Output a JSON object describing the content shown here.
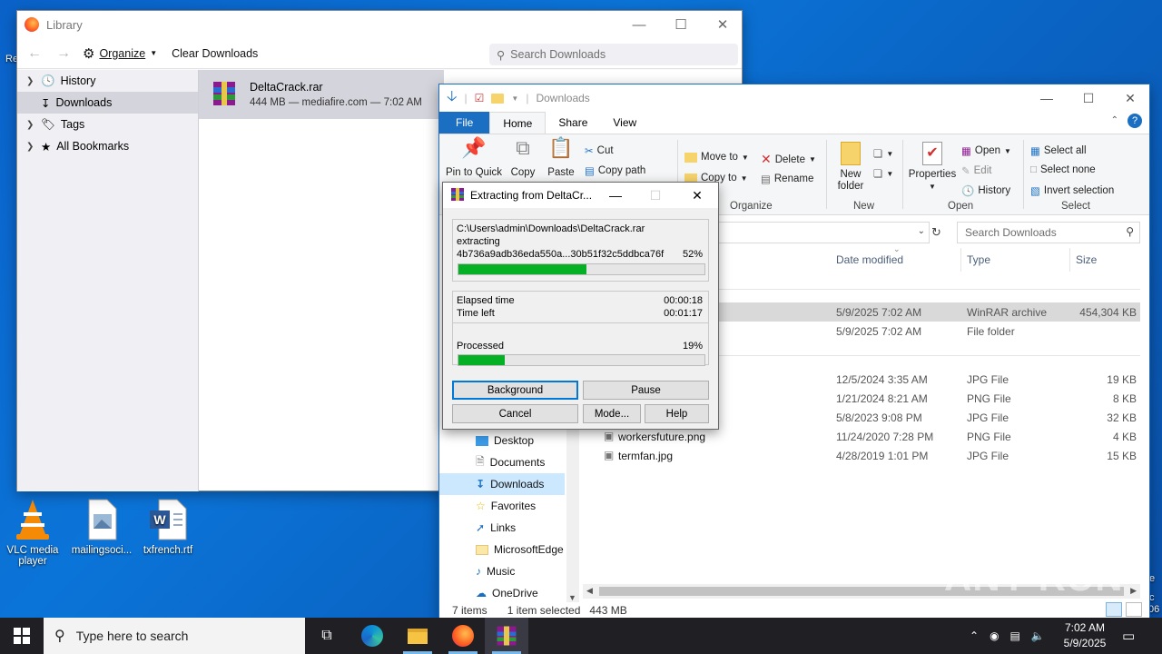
{
  "desktop": {
    "icons": [
      {
        "label": "VLC media player"
      },
      {
        "label": "mailingsoci..."
      },
      {
        "label": "txfrench.rtf"
      }
    ],
    "edge_fragments": {
      "top_left": "Re",
      "right_e": "e",
      "right_c": "c",
      "right_06": "06"
    }
  },
  "library": {
    "title": "Library",
    "toolbar": {
      "organize": "Organize",
      "clear_downloads": "Clear Downloads"
    },
    "search_placeholder": "Search Downloads",
    "sidebar": [
      "History",
      "Downloads",
      "Tags",
      "All Bookmarks"
    ],
    "download": {
      "name": "DeltaCrack.rar",
      "meta": "444 MB — mediafire.com — 7:02 AM"
    }
  },
  "explorer": {
    "title": "Downloads",
    "tabs": [
      "File",
      "Home",
      "Share",
      "View"
    ],
    "ribbon": {
      "pin": "Pin to Quick",
      "copy": "Copy",
      "paste": "Paste",
      "cut": "Cut",
      "copy_path": "Copy path",
      "move_to": "Move to",
      "copy_to": "Copy to",
      "delete": "Delete",
      "rename": "Rename",
      "new_folder": "New folder",
      "properties": "Properties",
      "open": "Open",
      "edit": "Edit",
      "history": "History",
      "select_all": "Select all",
      "select_none": "Select none",
      "invert_selection": "Invert selection",
      "groups": {
        "organize": "Organize",
        "new": "New",
        "open": "Open",
        "select": "Select"
      }
    },
    "search_placeholder": "Search Downloads",
    "columns": {
      "date": "Date modified",
      "type": "Type",
      "size": "Size"
    },
    "files": [
      {
        "name": "",
        "date": "5/9/2025 7:02 AM",
        "type": "WinRAR archive",
        "size": "454,304 KB",
        "selected": true
      },
      {
        "name": "",
        "date": "5/9/2025 7:02 AM",
        "type": "File folder",
        "size": ""
      },
      {
        "name": "",
        "date": "12/5/2024 3:35 AM",
        "type": "JPG File",
        "size": "19 KB"
      },
      {
        "name": "",
        "date": "1/21/2024 8:21 AM",
        "type": "PNG File",
        "size": "8 KB"
      },
      {
        "name": "",
        "date": "5/8/2023 9:08 PM",
        "type": "JPG File",
        "size": "32 KB"
      },
      {
        "name": "workersfuture.png",
        "date": "11/24/2020 7:28 PM",
        "type": "PNG File",
        "size": "4 KB"
      },
      {
        "name": "termfan.jpg",
        "date": "4/28/2019 1:01 PM",
        "type": "JPG File",
        "size": "15 KB"
      }
    ],
    "nav": [
      "Desktop",
      "Documents",
      "Downloads",
      "Favorites",
      "Links",
      "MicrosoftEdge",
      "Music",
      "OneDrive"
    ],
    "status": {
      "items": "7 items",
      "selected": "1 item selected",
      "size": "443 MB"
    }
  },
  "winrar": {
    "title": "Extracting from DeltaCr...",
    "path": "C:\\Users\\admin\\Downloads\\DeltaCrack.rar",
    "action": "extracting",
    "file": "4b736a9adb36eda550a...30b51f32c5ddbca76f",
    "file_pct_label": "52%",
    "file_progress": 0.52,
    "elapsed_label": "Elapsed time",
    "elapsed": "00:00:18",
    "left_label": "Time left",
    "left": "00:01:17",
    "processed_label": "Processed",
    "processed_pct_label": "19%",
    "processed_progress": 0.19,
    "buttons": {
      "background": "Background",
      "pause": "Pause",
      "cancel": "Cancel",
      "mode": "Mode...",
      "help": "Help"
    }
  },
  "taskbar": {
    "search_placeholder": "Type here to search",
    "time": "7:02 AM",
    "date": "5/9/2025"
  },
  "watermark": "ANY RUN"
}
